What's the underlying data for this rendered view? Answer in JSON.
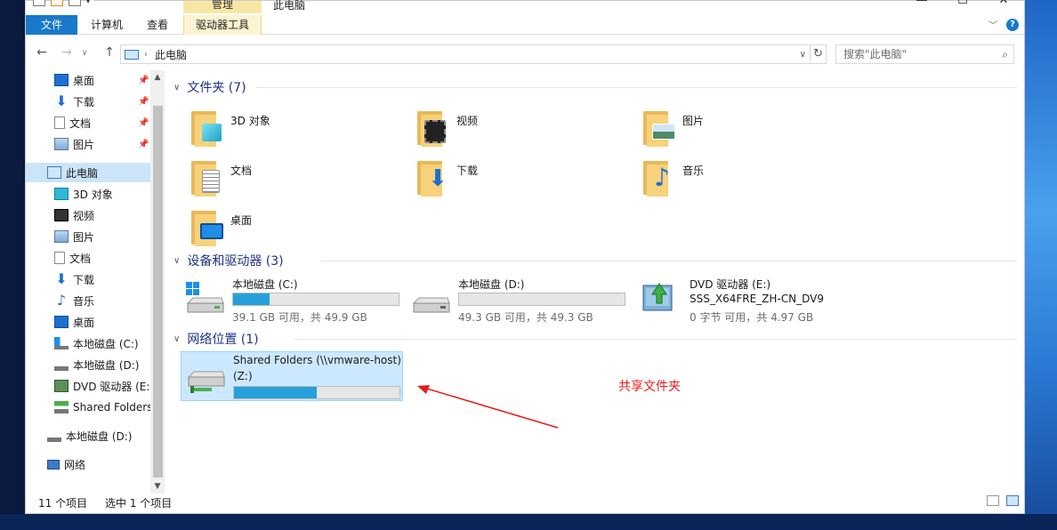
{
  "window": {
    "title": "此电脑",
    "context_group": "管理",
    "controls": [
      "—",
      "☐",
      "✕"
    ]
  },
  "ribbon": {
    "tabs": [
      "文件",
      "计算机",
      "查看",
      "驱动器工具"
    ],
    "help": "?"
  },
  "address": {
    "path": "此电脑",
    "search_placeholder": "搜索\"此电脑\""
  },
  "sidebar": {
    "quick_access": [
      {
        "label": "桌面",
        "icon": "desktop-icon"
      },
      {
        "label": "下载",
        "icon": "download-icon"
      },
      {
        "label": "文档",
        "icon": "document-icon"
      },
      {
        "label": "图片",
        "icon": "picture-icon"
      }
    ],
    "this_pc": "此电脑",
    "pc_children": [
      {
        "label": "3D 对象",
        "icon": "3d-objects-icon"
      },
      {
        "label": "视频",
        "icon": "video-icon"
      },
      {
        "label": "图片",
        "icon": "picture-icon"
      },
      {
        "label": "文档",
        "icon": "document-icon"
      },
      {
        "label": "下载",
        "icon": "download-icon"
      },
      {
        "label": "音乐",
        "icon": "music-icon"
      },
      {
        "label": "桌面",
        "icon": "desktop-icon"
      },
      {
        "label": "本地磁盘 (C:)",
        "icon": "windows-drive-icon"
      },
      {
        "label": "本地磁盘 (D:)",
        "icon": "drive-icon"
      },
      {
        "label": "DVD 驱动器 (E:",
        "icon": "dvd-icon"
      },
      {
        "label": "Shared Folders",
        "icon": "network-drive-icon"
      }
    ],
    "other": [
      {
        "label": "本地磁盘 (D:)",
        "icon": "drive-icon"
      },
      {
        "label": "网络",
        "icon": "network-icon"
      }
    ]
  },
  "groups": {
    "folders": {
      "header": "文件夹 (7)",
      "items": [
        {
          "label": "3D 对象",
          "icon": "3d-objects-folder-icon"
        },
        {
          "label": "视频",
          "icon": "video-folder-icon"
        },
        {
          "label": "图片",
          "icon": "picture-folder-icon"
        },
        {
          "label": "文档",
          "icon": "document-folder-icon"
        },
        {
          "label": "下载",
          "icon": "download-folder-icon"
        },
        {
          "label": "音乐",
          "icon": "music-folder-icon"
        },
        {
          "label": "桌面",
          "icon": "desktop-folder-icon"
        }
      ]
    },
    "devices": {
      "header": "设备和驱动器 (3)",
      "items": [
        {
          "name": "本地磁盘 (C:)",
          "size": "39.1 GB 可用，共 49.9 GB",
          "used_fraction": 0.22,
          "icon": "windows-drive-icon"
        },
        {
          "name": "本地磁盘 (D:)",
          "size": "49.3 GB 可用，共 49.3 GB",
          "used_fraction": 0.0,
          "icon": "drive-icon"
        },
        {
          "name": "DVD 驱动器 (E:)",
          "name2": "SSS_X64FRE_ZH-CN_DV9",
          "size": "0 字节 可用，共 4.97 GB",
          "icon": "dvd-icon"
        }
      ]
    },
    "network": {
      "header": "网络位置 (1)",
      "items": [
        {
          "name": "Shared Folders (\\\\vmware-host)",
          "name2": "(Z:)",
          "used_fraction": 0.5,
          "icon": "network-drive-icon"
        }
      ]
    }
  },
  "annotation": {
    "text": "共享文件夹",
    "color": "#e81b1b"
  },
  "status": {
    "count": "11 个项目",
    "selected": "选中 1 个项目"
  },
  "colors": {
    "accent": "#1979ca",
    "progress": "#26a0da",
    "selection": "#cce8ff",
    "group_header": "#1e3287"
  }
}
